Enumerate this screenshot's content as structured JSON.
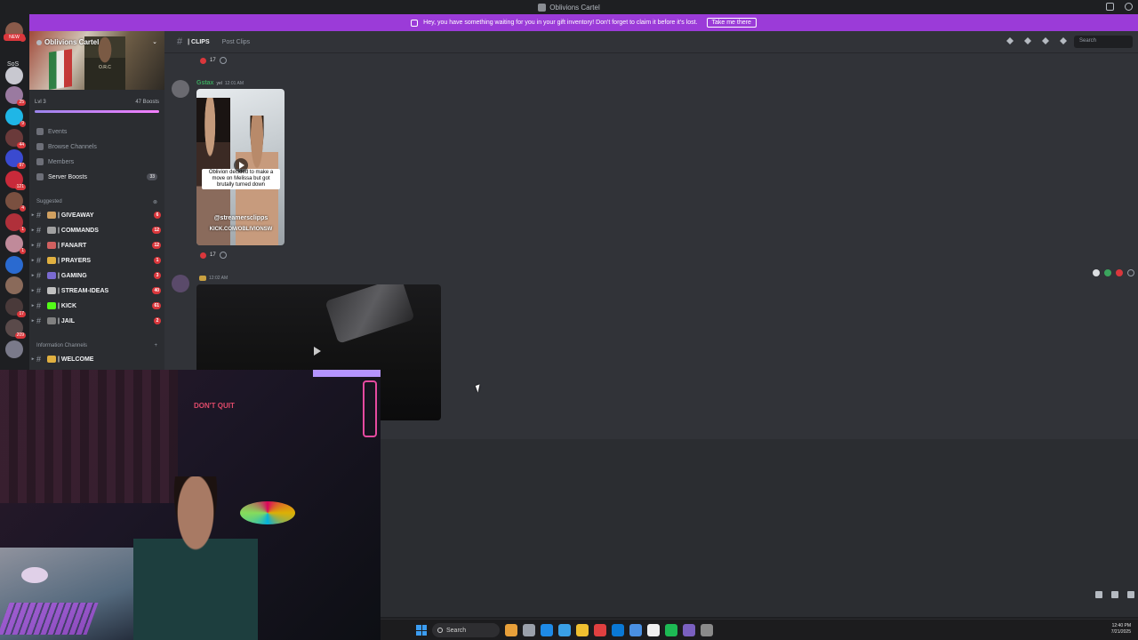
{
  "window": {
    "title": "Oblivions Cartel"
  },
  "banner": {
    "message": "Hey, you have something waiting for you in your gift inventory! Don't forget to claim it before it's lost.",
    "cta": "Take me there"
  },
  "guild_rail": {
    "new_label": "NEW",
    "sos_label": "SoS",
    "items": [
      {
        "badge": "2",
        "color": "#8a5a4a"
      },
      {
        "badge": "",
        "color": "#c8c8d0"
      },
      {
        "badge": "25",
        "color": "#9a7aa0"
      },
      {
        "badge": "9",
        "color": "#1fb6e6"
      },
      {
        "badge": "44",
        "color": "#6a3a3a"
      },
      {
        "badge": "97",
        "color": "#3a4ad0"
      },
      {
        "badge": "121",
        "color": "#c82a3a"
      },
      {
        "badge": "4",
        "color": "#7a5040"
      },
      {
        "badge": "1",
        "color": "#b0303a"
      },
      {
        "badge": "1",
        "color": "#c08a9a"
      },
      {
        "badge": "",
        "color": "#2a6ad0"
      },
      {
        "badge": "",
        "color": "#8a6a5a"
      },
      {
        "badge": "17",
        "color": "#4a3a3a"
      },
      {
        "badge": "209",
        "color": "#5a4a4a"
      },
      {
        "badge": "",
        "color": "#7a7a8a"
      }
    ]
  },
  "server": {
    "name": "Oblivions Cartel",
    "banner_text": "O.R.C",
    "level": "Lvl 3",
    "boosts": "47 Boosts",
    "boost_progress": 1.0,
    "nav": [
      {
        "label": "Events",
        "count": ""
      },
      {
        "label": "Browse Channels",
        "count": ""
      },
      {
        "label": "Members",
        "count": ""
      },
      {
        "label": "Server Boosts",
        "count": "33"
      }
    ],
    "suggested_label": "Suggested",
    "channels": [
      {
        "name": "| GIVEAWAY",
        "badge": "6",
        "emoji_color": "#d0a060"
      },
      {
        "name": "| COMMANDS",
        "badge": "12",
        "emoji_color": "#a0a0a0"
      },
      {
        "name": "| FANART",
        "badge": "12",
        "emoji_color": "#d06060"
      },
      {
        "name": "| PRAYERS",
        "badge": "1",
        "emoji_color": "#e0b040"
      },
      {
        "name": "| GAMING",
        "badge": "3",
        "emoji_color": "#7a6ad0"
      },
      {
        "name": "| STREAM-IDEAS",
        "badge": "40",
        "emoji_color": "#c0c0c0"
      },
      {
        "name": "| KICK",
        "badge": "61",
        "emoji_color": "#53fc18"
      },
      {
        "name": "| JAIL",
        "badge": "2",
        "emoji_color": "#808080"
      }
    ],
    "info_label": "Information Channels",
    "info_channels": [
      {
        "name": "| WELCOME",
        "emoji_color": "#e0b040"
      }
    ]
  },
  "channel": {
    "name": "| CLIPS",
    "post_label": "Post Clips",
    "search_placeholder": "Search"
  },
  "messages": [
    {
      "reaction_count": "17"
    },
    {
      "author": "Gstax",
      "tag": "yel",
      "timestamp": "12:01 AM",
      "video_caption": "Oblivion decided to make a move on Melissa but got brutally turned down",
      "watermark_handle": "@streamersclipps",
      "watermark_url": "KICK.COM/OBLIVIONSW",
      "reaction_count": "17"
    },
    {
      "author": "",
      "timestamp": "12:02 AM"
    }
  ],
  "webcam": {
    "sign_text": "DON'T QUIT"
  },
  "taskbar": {
    "search_label": "Search",
    "time": "12:40 PM",
    "date": "7/21/2025",
    "apps": [
      "#e8a03a",
      "#9aa0aa",
      "#1e8ae6",
      "#3aa0e6",
      "#f0c030",
      "#e04040",
      "#0a78d4",
      "#4a90e2",
      "#f0f0f0",
      "#1db954",
      "#7a60c0",
      "#8a8a8a"
    ]
  }
}
